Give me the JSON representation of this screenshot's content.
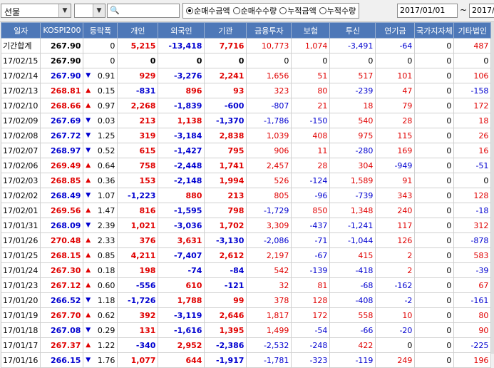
{
  "toolbar": {
    "market_select": "선물",
    "second_select": "",
    "search_value": "",
    "radio_options": [
      "순매수금액",
      "순매수수량",
      "누적금액",
      "누적수량"
    ],
    "radio_selected": 0,
    "date_from": "2017/01/01",
    "date_sep": "~",
    "date_to": "2017/"
  },
  "columns": [
    "일자",
    "KOSPI200",
    "등락폭",
    "개인",
    "외국인",
    "기관",
    "금융투자",
    "보험",
    "투신",
    "연기금",
    "국가지자체",
    "기타법인"
  ],
  "rows": [
    {
      "date": "기간합계",
      "kospi": "267.90",
      "dir": "",
      "chg": "0",
      "ind": "5,215",
      "for": "-13,418",
      "inst": "7,716",
      "fin": "10,773",
      "ins": "1,074",
      "inv": "-3,491",
      "pen": "-64",
      "gov": "0",
      "etc": "487"
    },
    {
      "date": "17/02/15",
      "kospi": "267.90",
      "dir": "",
      "chg": "0",
      "ind": "0",
      "for": "0",
      "inst": "0",
      "fin": "0",
      "ins": "0",
      "inv": "0",
      "pen": "0",
      "gov": "0",
      "etc": "0"
    },
    {
      "date": "17/02/14",
      "kospi": "267.90",
      "dir": "down",
      "chg": "0.91",
      "ind": "929",
      "for": "-3,276",
      "inst": "2,241",
      "fin": "1,656",
      "ins": "51",
      "inv": "517",
      "pen": "101",
      "gov": "0",
      "etc": "106"
    },
    {
      "date": "17/02/13",
      "kospi": "268.81",
      "dir": "up",
      "chg": "0.15",
      "ind": "-831",
      "for": "896",
      "inst": "93",
      "fin": "323",
      "ins": "80",
      "inv": "-239",
      "pen": "47",
      "gov": "0",
      "etc": "-158"
    },
    {
      "date": "17/02/10",
      "kospi": "268.66",
      "dir": "up",
      "chg": "0.97",
      "ind": "2,268",
      "for": "-1,839",
      "inst": "-600",
      "fin": "-807",
      "ins": "21",
      "inv": "18",
      "pen": "79",
      "gov": "0",
      "etc": "172"
    },
    {
      "date": "17/02/09",
      "kospi": "267.69",
      "dir": "down",
      "chg": "0.03",
      "ind": "213",
      "for": "1,138",
      "inst": "-1,370",
      "fin": "-1,786",
      "ins": "-150",
      "inv": "540",
      "pen": "28",
      "gov": "0",
      "etc": "18"
    },
    {
      "date": "17/02/08",
      "kospi": "267.72",
      "dir": "down",
      "chg": "1.25",
      "ind": "319",
      "for": "-3,184",
      "inst": "2,838",
      "fin": "1,039",
      "ins": "408",
      "inv": "975",
      "pen": "115",
      "gov": "0",
      "etc": "26"
    },
    {
      "date": "17/02/07",
      "kospi": "268.97",
      "dir": "down",
      "chg": "0.52",
      "ind": "615",
      "for": "-1,427",
      "inst": "795",
      "fin": "906",
      "ins": "11",
      "inv": "-280",
      "pen": "169",
      "gov": "0",
      "etc": "16"
    },
    {
      "date": "17/02/06",
      "kospi": "269.49",
      "dir": "up",
      "chg": "0.64",
      "ind": "758",
      "for": "-2,448",
      "inst": "1,741",
      "fin": "2,457",
      "ins": "28",
      "inv": "304",
      "pen": "-949",
      "gov": "0",
      "etc": "-51"
    },
    {
      "date": "17/02/03",
      "kospi": "268.85",
      "dir": "up",
      "chg": "0.36",
      "ind": "153",
      "for": "-2,148",
      "inst": "1,994",
      "fin": "526",
      "ins": "-124",
      "inv": "1,589",
      "pen": "91",
      "gov": "0",
      "etc": "0"
    },
    {
      "date": "17/02/02",
      "kospi": "268.49",
      "dir": "down",
      "chg": "1.07",
      "ind": "-1,223",
      "for": "880",
      "inst": "213",
      "fin": "805",
      "ins": "-96",
      "inv": "-739",
      "pen": "343",
      "gov": "0",
      "etc": "128"
    },
    {
      "date": "17/02/01",
      "kospi": "269.56",
      "dir": "up",
      "chg": "1.47",
      "ind": "816",
      "for": "-1,595",
      "inst": "798",
      "fin": "-1,729",
      "ins": "850",
      "inv": "1,348",
      "pen": "240",
      "gov": "0",
      "etc": "-18"
    },
    {
      "date": "17/01/31",
      "kospi": "268.09",
      "dir": "down",
      "chg": "2.39",
      "ind": "1,021",
      "for": "-3,036",
      "inst": "1,702",
      "fin": "3,309",
      "ins": "-437",
      "inv": "-1,241",
      "pen": "117",
      "gov": "0",
      "etc": "312"
    },
    {
      "date": "17/01/26",
      "kospi": "270.48",
      "dir": "up",
      "chg": "2.33",
      "ind": "376",
      "for": "3,631",
      "inst": "-3,130",
      "fin": "-2,086",
      "ins": "-71",
      "inv": "-1,044",
      "pen": "126",
      "gov": "0",
      "etc": "-878"
    },
    {
      "date": "17/01/25",
      "kospi": "268.15",
      "dir": "up",
      "chg": "0.85",
      "ind": "4,211",
      "for": "-7,407",
      "inst": "2,612",
      "fin": "2,197",
      "ins": "-67",
      "inv": "415",
      "pen": "2",
      "gov": "0",
      "etc": "583"
    },
    {
      "date": "17/01/24",
      "kospi": "267.30",
      "dir": "up",
      "chg": "0.18",
      "ind": "198",
      "for": "-74",
      "inst": "-84",
      "fin": "542",
      "ins": "-139",
      "inv": "-418",
      "pen": "2",
      "gov": "0",
      "etc": "-39"
    },
    {
      "date": "17/01/23",
      "kospi": "267.12",
      "dir": "up",
      "chg": "0.60",
      "ind": "-556",
      "for": "610",
      "inst": "-121",
      "fin": "32",
      "ins": "81",
      "inv": "-68",
      "pen": "-162",
      "gov": "0",
      "etc": "67"
    },
    {
      "date": "17/01/20",
      "kospi": "266.52",
      "dir": "down",
      "chg": "1.18",
      "ind": "-1,726",
      "for": "1,788",
      "inst": "99",
      "fin": "378",
      "ins": "128",
      "inv": "-408",
      "pen": "-2",
      "gov": "0",
      "etc": "-161"
    },
    {
      "date": "17/01/19",
      "kospi": "267.70",
      "dir": "up",
      "chg": "0.62",
      "ind": "392",
      "for": "-3,119",
      "inst": "2,646",
      "fin": "1,817",
      "ins": "172",
      "inv": "558",
      "pen": "10",
      "gov": "0",
      "etc": "80"
    },
    {
      "date": "17/01/18",
      "kospi": "267.08",
      "dir": "down",
      "chg": "0.29",
      "ind": "131",
      "for": "-1,616",
      "inst": "1,395",
      "fin": "1,499",
      "ins": "-54",
      "inv": "-66",
      "pen": "-20",
      "gov": "0",
      "etc": "90"
    },
    {
      "date": "17/01/17",
      "kospi": "267.37",
      "dir": "up",
      "chg": "1.22",
      "ind": "-340",
      "for": "2,952",
      "inst": "-2,386",
      "fin": "-2,532",
      "ins": "-248",
      "inv": "422",
      "pen": "0",
      "gov": "0",
      "etc": "-225"
    },
    {
      "date": "17/01/16",
      "kospi": "266.15",
      "dir": "down",
      "chg": "1.76",
      "ind": "1,077",
      "for": "644",
      "inst": "-1,917",
      "fin": "-1,781",
      "ins": "-323",
      "inv": "-119",
      "pen": "249",
      "gov": "0",
      "etc": "196"
    }
  ],
  "colors": {
    "header_bg": "#4e78b8",
    "up": "#e00000",
    "down": "#0000d0"
  }
}
